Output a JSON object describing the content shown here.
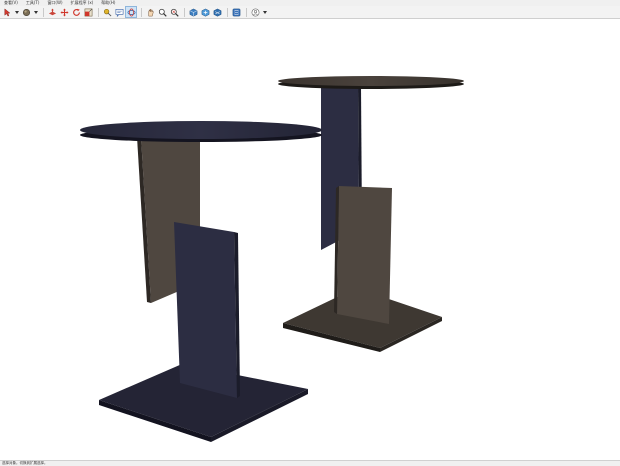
{
  "menubar": {
    "items": [
      {
        "label": "查看(V)"
      },
      {
        "label": "工具(T)"
      },
      {
        "label": "窗口(W)"
      },
      {
        "label": "扩展程序 (x)"
      },
      {
        "label": "帮助(H)"
      }
    ]
  },
  "toolbar": {
    "tools": [
      {
        "icon": "select-arrow-icon",
        "dropdown": true
      },
      {
        "icon": "paint-bucket-icon",
        "dropdown": true
      },
      {
        "icon": "push-pull-icon"
      },
      {
        "icon": "move-icon"
      },
      {
        "icon": "rotate-icon"
      },
      {
        "icon": "scale-icon"
      },
      {
        "icon": "tape-measure-icon"
      },
      {
        "icon": "text-label-icon"
      },
      {
        "icon": "orbit-icon",
        "active": true
      },
      {
        "icon": "pan-icon"
      },
      {
        "icon": "zoom-icon"
      },
      {
        "icon": "zoom-extents-icon"
      },
      {
        "icon": "warehouse-icon"
      },
      {
        "icon": "extension-warehouse-icon"
      },
      {
        "icon": "layout-icon"
      },
      {
        "icon": "extension-manager-icon"
      },
      {
        "icon": "account-icon",
        "dropdown": true
      }
    ]
  },
  "statusbar": {
    "text": "选择对象。切换到扩展选择。"
  },
  "colors": {
    "navy": "#2a2b40",
    "brown": "#4f4740",
    "viewport_bg": "#ffffff"
  }
}
